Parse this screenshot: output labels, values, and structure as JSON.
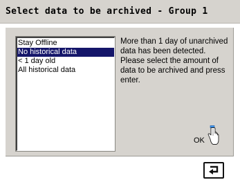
{
  "window": {
    "title": "Select data to be archived - Group 1"
  },
  "list": {
    "items": [
      {
        "label": "Stay Offline",
        "selected": false
      },
      {
        "label": "No historical data",
        "selected": true
      },
      {
        "label": "< 1 day old",
        "selected": false
      },
      {
        "label": "All historical data",
        "selected": false
      }
    ]
  },
  "message": {
    "text": "More than 1 day of unarchived data has been detected. Please select the amount of data to be archived and press enter."
  },
  "ok": {
    "label": "OK",
    "icon": "pointing-hand-icon"
  },
  "footer": {
    "enter_icon": "enter-key-icon"
  },
  "colors": {
    "panel": "#d6d3ce",
    "selection": "#15166a",
    "list_background": "#ffffff"
  }
}
